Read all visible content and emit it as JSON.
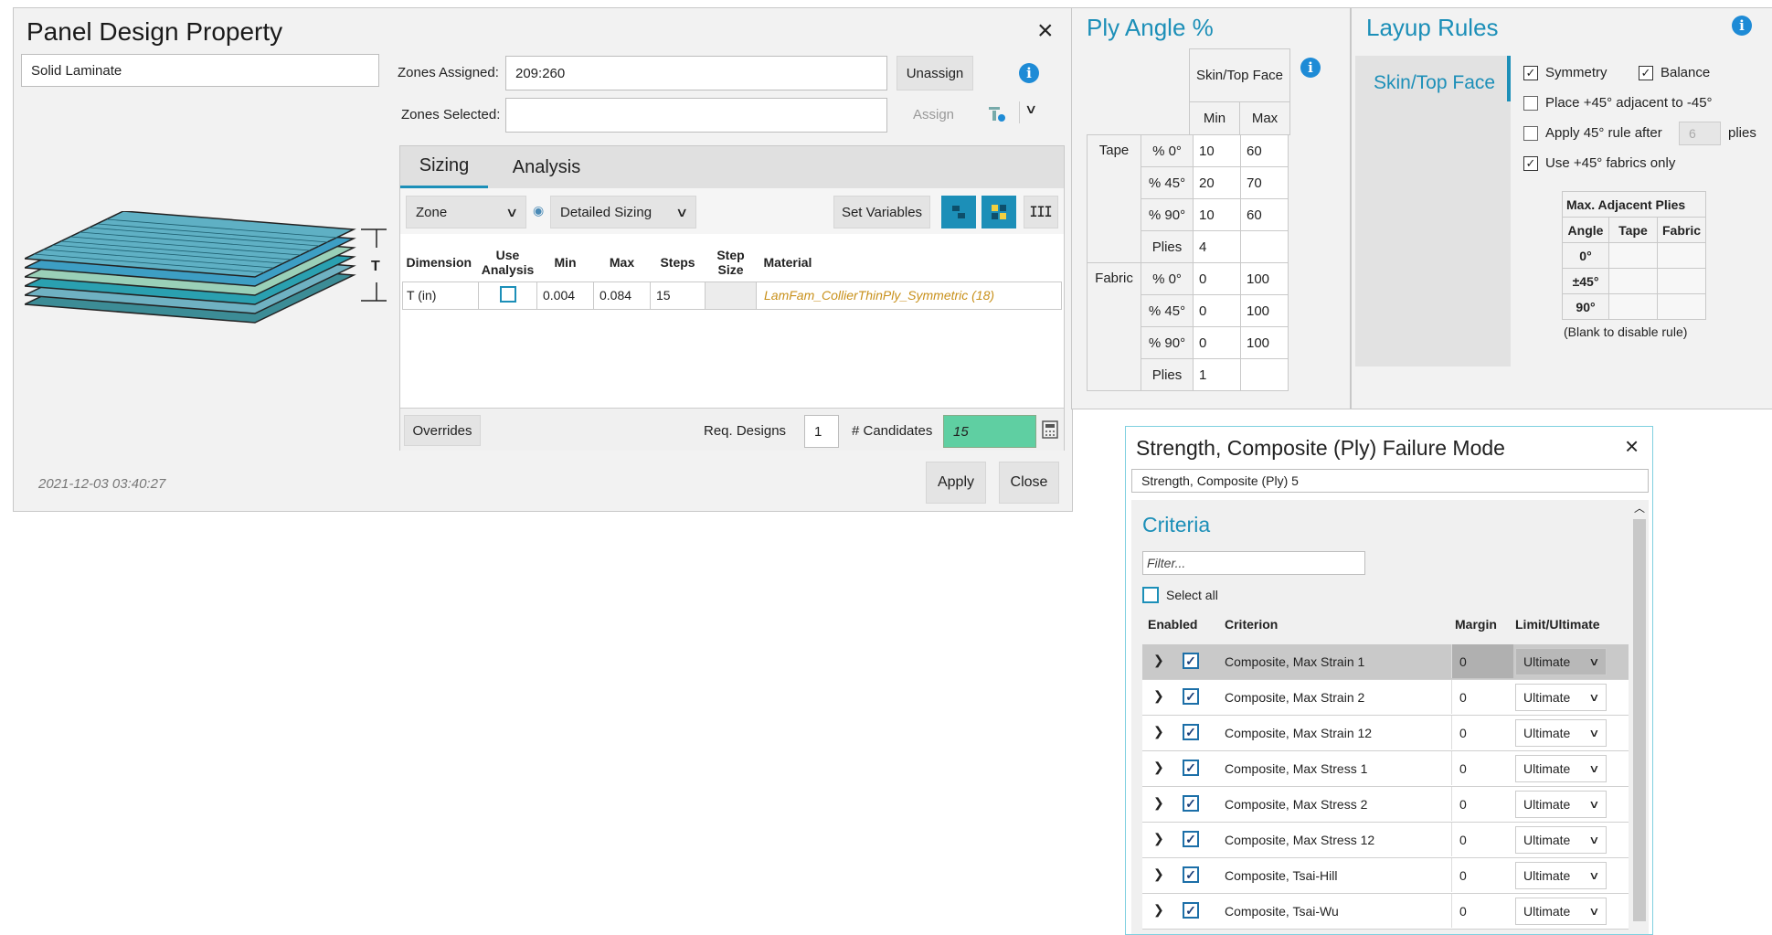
{
  "panel": {
    "title": "Panel Design Property",
    "close": "×",
    "name_value": "Solid Laminate",
    "zones_assigned_label": "Zones Assigned:",
    "zones_assigned_value": "209:260",
    "unassign": "Unassign",
    "zones_selected_label": "Zones Selected:",
    "zones_selected_value": "",
    "assign": "Assign",
    "diagram_dim_label": "T",
    "tabs": [
      "Sizing",
      "Analysis"
    ],
    "zone_select": "Zone",
    "sizing_select": "Detailed Sizing",
    "set_variables": "Set Variables",
    "table_headers": {
      "dimension": "Dimension",
      "use_analysis": "Use Analysis",
      "min": "Min",
      "max": "Max",
      "steps": "Steps",
      "step_size": "Step Size",
      "material": "Material"
    },
    "row": {
      "dimension": "T (in)",
      "min": "0.004",
      "max": "0.084",
      "steps": "15",
      "step_size": "",
      "material": "LamFam_CollierThinPly_Symmetric (18)"
    },
    "overrides": "Overrides",
    "req_designs_label": "Req. Designs",
    "req_designs_value": "1",
    "candidates_label": "# Candidates",
    "candidates_value": "15",
    "timestamp": "2021-12-03 03:40:27",
    "apply": "Apply",
    "close_btn": "Close"
  },
  "ply_angle": {
    "title": "Ply Angle %",
    "header_group": "Skin/Top Face",
    "col_min": "Min",
    "col_max": "Max",
    "groups": [
      {
        "name": "Tape",
        "rows": [
          {
            "label": "% 0°",
            "min": "10",
            "max": "60"
          },
          {
            "label": "% 45°",
            "min": "20",
            "max": "70"
          },
          {
            "label": "% 90°",
            "min": "10",
            "max": "60"
          },
          {
            "label": "Plies",
            "min": "4",
            "max": ""
          }
        ]
      },
      {
        "name": "Fabric",
        "rows": [
          {
            "label": "% 0°",
            "min": "0",
            "max": "100"
          },
          {
            "label": "% 45°",
            "min": "0",
            "max": "100"
          },
          {
            "label": "% 90°",
            "min": "0",
            "max": "100"
          },
          {
            "label": "Plies",
            "min": "1",
            "max": ""
          }
        ]
      }
    ]
  },
  "layup": {
    "title": "Layup Rules",
    "side_item": "Skin/Top Face",
    "symmetry": "Symmetry",
    "balance": "Balance",
    "place45": "Place +45° adjacent to -45°",
    "apply45": "Apply 45° rule after",
    "apply45_value": "6",
    "plies": "plies",
    "use45": "Use +45° fabrics only",
    "max_adj_title": "Max. Adjacent Plies",
    "col_angle": "Angle",
    "col_tape": "Tape",
    "col_fabric": "Fabric",
    "angles": [
      "0°",
      "±45°",
      "90°"
    ],
    "note": "(Blank to disable rule)"
  },
  "strength": {
    "title": "Strength, Composite (Ply) Failure Mode",
    "close": "×",
    "name_value": "Strength, Composite (Ply) 5",
    "criteria": "Criteria",
    "filter_placeholder": "Filter...",
    "select_all": "Select all",
    "col_enabled": "Enabled",
    "col_criterion": "Criterion",
    "col_margin": "Margin",
    "col_limit": "Limit/Ultimate",
    "rows": [
      {
        "criterion": "Composite, Max Strain 1",
        "margin": "0",
        "limit": "Ultimate"
      },
      {
        "criterion": "Composite, Max Strain 2",
        "margin": "0",
        "limit": "Ultimate"
      },
      {
        "criterion": "Composite, Max Strain 12",
        "margin": "0",
        "limit": "Ultimate"
      },
      {
        "criterion": "Composite, Max Stress 1",
        "margin": "0",
        "limit": "Ultimate"
      },
      {
        "criterion": "Composite, Max Stress 2",
        "margin": "0",
        "limit": "Ultimate"
      },
      {
        "criterion": "Composite, Max Stress 12",
        "margin": "0",
        "limit": "Ultimate"
      },
      {
        "criterion": "Composite, Tsai-Hill",
        "margin": "0",
        "limit": "Ultimate"
      },
      {
        "criterion": "Composite, Tsai-Wu",
        "margin": "0",
        "limit": "Ultimate"
      }
    ]
  },
  "colors": {
    "accent": "#1c8fb8",
    "candidates_bg": "#5fcfa2",
    "material_text": "#c8901a",
    "info": "#1e8bd6"
  }
}
